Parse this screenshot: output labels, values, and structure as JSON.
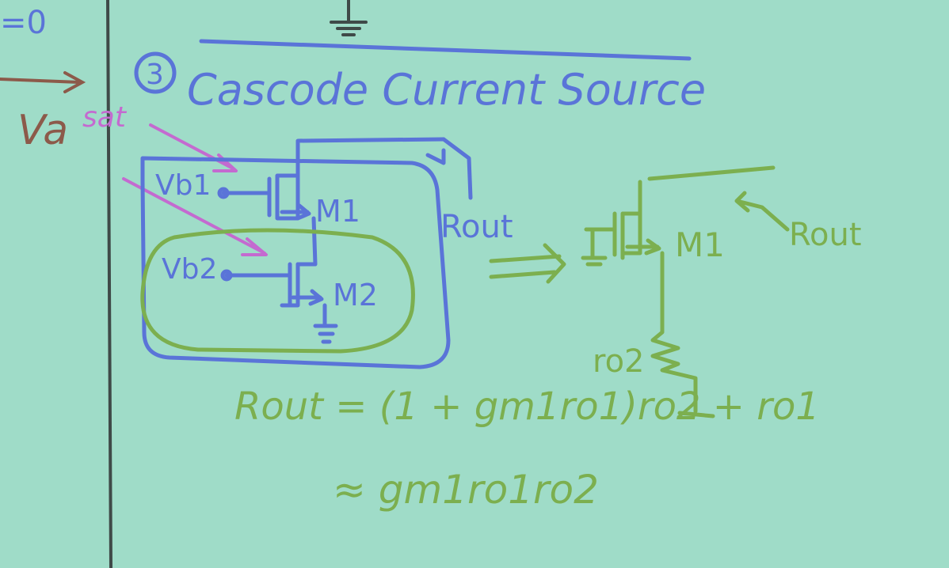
{
  "colors": {
    "board": "#9fdcc8",
    "marker_blue": "#5a74d8",
    "marker_green": "#7caf4f",
    "marker_pink": "#c46ad0",
    "marker_brown": "#8c5a4a",
    "border_line": "#3f4a48"
  },
  "left_fragments": {
    "top_text": "=0",
    "va_label": "Va"
  },
  "heading": {
    "number": "3",
    "title": "Cascode Current Source"
  },
  "annotation": {
    "sat": "sat"
  },
  "circuit_left": {
    "vb1": "Vb1",
    "vb2": "Vb2",
    "m1": "M1",
    "m2": "M2",
    "rout": "Rout"
  },
  "circuit_right": {
    "m1": "M1",
    "rout": "Rout",
    "ro2": "ro2"
  },
  "equations": {
    "line1": "Rout = (1 + gm1ro1)ro2 + ro1",
    "line2": "≈ gm1ro1ro2"
  }
}
